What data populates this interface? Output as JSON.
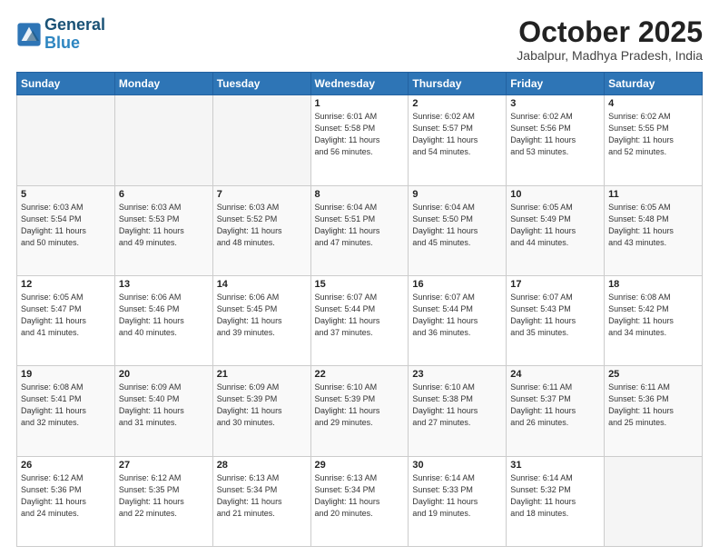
{
  "logo": {
    "line1": "General",
    "line2": "Blue"
  },
  "title": "October 2025",
  "location": "Jabalpur, Madhya Pradesh, India",
  "weekdays": [
    "Sunday",
    "Monday",
    "Tuesday",
    "Wednesday",
    "Thursday",
    "Friday",
    "Saturday"
  ],
  "weeks": [
    [
      {
        "day": "",
        "info": ""
      },
      {
        "day": "",
        "info": ""
      },
      {
        "day": "",
        "info": ""
      },
      {
        "day": "1",
        "info": "Sunrise: 6:01 AM\nSunset: 5:58 PM\nDaylight: 11 hours\nand 56 minutes."
      },
      {
        "day": "2",
        "info": "Sunrise: 6:02 AM\nSunset: 5:57 PM\nDaylight: 11 hours\nand 54 minutes."
      },
      {
        "day": "3",
        "info": "Sunrise: 6:02 AM\nSunset: 5:56 PM\nDaylight: 11 hours\nand 53 minutes."
      },
      {
        "day": "4",
        "info": "Sunrise: 6:02 AM\nSunset: 5:55 PM\nDaylight: 11 hours\nand 52 minutes."
      }
    ],
    [
      {
        "day": "5",
        "info": "Sunrise: 6:03 AM\nSunset: 5:54 PM\nDaylight: 11 hours\nand 50 minutes."
      },
      {
        "day": "6",
        "info": "Sunrise: 6:03 AM\nSunset: 5:53 PM\nDaylight: 11 hours\nand 49 minutes."
      },
      {
        "day": "7",
        "info": "Sunrise: 6:03 AM\nSunset: 5:52 PM\nDaylight: 11 hours\nand 48 minutes."
      },
      {
        "day": "8",
        "info": "Sunrise: 6:04 AM\nSunset: 5:51 PM\nDaylight: 11 hours\nand 47 minutes."
      },
      {
        "day": "9",
        "info": "Sunrise: 6:04 AM\nSunset: 5:50 PM\nDaylight: 11 hours\nand 45 minutes."
      },
      {
        "day": "10",
        "info": "Sunrise: 6:05 AM\nSunset: 5:49 PM\nDaylight: 11 hours\nand 44 minutes."
      },
      {
        "day": "11",
        "info": "Sunrise: 6:05 AM\nSunset: 5:48 PM\nDaylight: 11 hours\nand 43 minutes."
      }
    ],
    [
      {
        "day": "12",
        "info": "Sunrise: 6:05 AM\nSunset: 5:47 PM\nDaylight: 11 hours\nand 41 minutes."
      },
      {
        "day": "13",
        "info": "Sunrise: 6:06 AM\nSunset: 5:46 PM\nDaylight: 11 hours\nand 40 minutes."
      },
      {
        "day": "14",
        "info": "Sunrise: 6:06 AM\nSunset: 5:45 PM\nDaylight: 11 hours\nand 39 minutes."
      },
      {
        "day": "15",
        "info": "Sunrise: 6:07 AM\nSunset: 5:44 PM\nDaylight: 11 hours\nand 37 minutes."
      },
      {
        "day": "16",
        "info": "Sunrise: 6:07 AM\nSunset: 5:44 PM\nDaylight: 11 hours\nand 36 minutes."
      },
      {
        "day": "17",
        "info": "Sunrise: 6:07 AM\nSunset: 5:43 PM\nDaylight: 11 hours\nand 35 minutes."
      },
      {
        "day": "18",
        "info": "Sunrise: 6:08 AM\nSunset: 5:42 PM\nDaylight: 11 hours\nand 34 minutes."
      }
    ],
    [
      {
        "day": "19",
        "info": "Sunrise: 6:08 AM\nSunset: 5:41 PM\nDaylight: 11 hours\nand 32 minutes."
      },
      {
        "day": "20",
        "info": "Sunrise: 6:09 AM\nSunset: 5:40 PM\nDaylight: 11 hours\nand 31 minutes."
      },
      {
        "day": "21",
        "info": "Sunrise: 6:09 AM\nSunset: 5:39 PM\nDaylight: 11 hours\nand 30 minutes."
      },
      {
        "day": "22",
        "info": "Sunrise: 6:10 AM\nSunset: 5:39 PM\nDaylight: 11 hours\nand 29 minutes."
      },
      {
        "day": "23",
        "info": "Sunrise: 6:10 AM\nSunset: 5:38 PM\nDaylight: 11 hours\nand 27 minutes."
      },
      {
        "day": "24",
        "info": "Sunrise: 6:11 AM\nSunset: 5:37 PM\nDaylight: 11 hours\nand 26 minutes."
      },
      {
        "day": "25",
        "info": "Sunrise: 6:11 AM\nSunset: 5:36 PM\nDaylight: 11 hours\nand 25 minutes."
      }
    ],
    [
      {
        "day": "26",
        "info": "Sunrise: 6:12 AM\nSunset: 5:36 PM\nDaylight: 11 hours\nand 24 minutes."
      },
      {
        "day": "27",
        "info": "Sunrise: 6:12 AM\nSunset: 5:35 PM\nDaylight: 11 hours\nand 22 minutes."
      },
      {
        "day": "28",
        "info": "Sunrise: 6:13 AM\nSunset: 5:34 PM\nDaylight: 11 hours\nand 21 minutes."
      },
      {
        "day": "29",
        "info": "Sunrise: 6:13 AM\nSunset: 5:34 PM\nDaylight: 11 hours\nand 20 minutes."
      },
      {
        "day": "30",
        "info": "Sunrise: 6:14 AM\nSunset: 5:33 PM\nDaylight: 11 hours\nand 19 minutes."
      },
      {
        "day": "31",
        "info": "Sunrise: 6:14 AM\nSunset: 5:32 PM\nDaylight: 11 hours\nand 18 minutes."
      },
      {
        "day": "",
        "info": ""
      }
    ]
  ]
}
